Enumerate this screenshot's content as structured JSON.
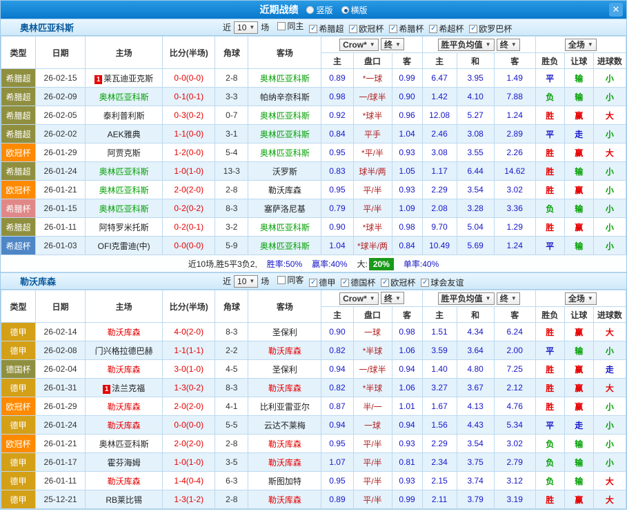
{
  "topbar": {
    "title": "近期战绩",
    "layout_options": [
      {
        "label": "竖版",
        "selected": false
      },
      {
        "label": "横版",
        "selected": true
      }
    ],
    "close_label": "✕"
  },
  "controls": {
    "recent_prefix": "近",
    "recent_count": "10",
    "recent_suffix": "场",
    "dropdown_crow": "Crow*",
    "dropdown_final_asia": "终",
    "dropdown_avg": "胜平负均值",
    "dropdown_final_eu": "终",
    "dropdown_scope": "全场"
  },
  "columns": {
    "type": "类型",
    "date": "日期",
    "home": "主场",
    "score": "比分(半场)",
    "corner": "角球",
    "away": "客场",
    "asia_home": "主",
    "asia_handicap": "盘口",
    "asia_away": "客",
    "eu_home": "主",
    "eu_draw": "和",
    "eu_away": "客",
    "result": "胜负",
    "handicap_result": "让球",
    "goals": "进球数"
  },
  "league_colors": {
    "希腊超": "#8f8f3f",
    "欧冠杯": "#ff8a00",
    "希腊杯": "#e08888",
    "希超杯": "#4e86c6",
    "德甲": "#d4a017",
    "德国杯": "#8f8f3f"
  },
  "value_colors": {
    "胜": "#e60000",
    "平": "#1616c8",
    "负": "#00a000",
    "赢": "#e60000",
    "走": "#1616c8",
    "输": "#00a000",
    "大": "#e60000",
    "小": "#00a000"
  },
  "sections": [
    {
      "team": "奥林匹亚科斯",
      "team_color": "#00a000",
      "filters": [
        {
          "label": "同主",
          "checked": false
        },
        {
          "label": "希腊超",
          "checked": true
        },
        {
          "label": "欧冠杯",
          "checked": true
        },
        {
          "label": "希腊杯",
          "checked": true
        },
        {
          "label": "希超杯",
          "checked": true
        },
        {
          "label": "欧罗巴杯",
          "checked": true
        }
      ],
      "rows": [
        {
          "league": "希腊超",
          "date": "26-02-15",
          "home": "莱瓦迪亚克斯",
          "home_card": "1",
          "away": "奥林匹亚科斯",
          "away_hl": true,
          "score": "0-0(0-0)",
          "corner": "2-8",
          "a_home": "0.89",
          "a_hcp": "*一球",
          "a_away": "0.99",
          "e_home": "6.47",
          "e_draw": "3.95",
          "e_away": "1.49",
          "result": "平",
          "hcp_res": "输",
          "goals": "小"
        },
        {
          "league": "希腊超",
          "date": "26-02-09",
          "home": "奥林匹亚科斯",
          "home_hl": true,
          "away": "帕纳辛奈科斯",
          "score": "0-1(0-1)",
          "corner": "3-3",
          "a_home": "0.98",
          "a_hcp": "一/球半",
          "a_away": "0.90",
          "e_home": "1.42",
          "e_draw": "4.10",
          "e_away": "7.88",
          "result": "负",
          "hcp_res": "输",
          "goals": "小"
        },
        {
          "league": "希腊超",
          "date": "26-02-05",
          "home": "泰利普利斯",
          "away": "奥林匹亚科斯",
          "away_hl": true,
          "score": "0-3(0-2)",
          "corner": "0-7",
          "a_home": "0.92",
          "a_hcp": "*球半",
          "a_away": "0.96",
          "e_home": "12.08",
          "e_draw": "5.27",
          "e_away": "1.24",
          "result": "胜",
          "hcp_res": "赢",
          "goals": "大"
        },
        {
          "league": "希腊超",
          "date": "26-02-02",
          "home": "AEK雅典",
          "away": "奥林匹亚科斯",
          "away_hl": true,
          "score": "1-1(0-0)",
          "corner": "3-1",
          "a_home": "0.84",
          "a_hcp": "平手",
          "a_away": "1.04",
          "e_home": "2.46",
          "e_draw": "3.08",
          "e_away": "2.89",
          "result": "平",
          "hcp_res": "走",
          "goals": "小"
        },
        {
          "league": "欧冠杯",
          "date": "26-01-29",
          "home": "阿贾克斯",
          "away": "奥林匹亚科斯",
          "away_hl": true,
          "score": "1-2(0-0)",
          "corner": "5-4",
          "a_home": "0.95",
          "a_hcp": "*平/半",
          "a_away": "0.93",
          "e_home": "3.08",
          "e_draw": "3.55",
          "e_away": "2.26",
          "result": "胜",
          "hcp_res": "赢",
          "goals": "大"
        },
        {
          "league": "希腊超",
          "date": "26-01-24",
          "home": "奥林匹亚科斯",
          "home_hl": true,
          "away": "沃罗斯",
          "score": "1-0(1-0)",
          "corner": "13-3",
          "a_home": "0.83",
          "a_hcp": "球半/两",
          "a_away": "1.05",
          "e_home": "1.17",
          "e_draw": "6.44",
          "e_away": "14.62",
          "result": "胜",
          "hcp_res": "输",
          "goals": "小"
        },
        {
          "league": "欧冠杯",
          "date": "26-01-21",
          "home": "奥林匹亚科斯",
          "home_hl": true,
          "away": "勒沃库森",
          "score": "2-0(2-0)",
          "corner": "2-8",
          "a_home": "0.95",
          "a_hcp": "平/半",
          "a_away": "0.93",
          "e_home": "2.29",
          "e_draw": "3.54",
          "e_away": "3.02",
          "result": "胜",
          "hcp_res": "赢",
          "goals": "小"
        },
        {
          "league": "希腊杯",
          "date": "26-01-15",
          "home": "奥林匹亚科斯",
          "home_hl": true,
          "away": "塞萨洛尼基",
          "score": "0-2(0-2)",
          "corner": "8-3",
          "a_home": "0.79",
          "a_hcp": "平/半",
          "a_away": "1.09",
          "e_home": "2.08",
          "e_draw": "3.28",
          "e_away": "3.36",
          "result": "负",
          "hcp_res": "输",
          "goals": "小"
        },
        {
          "league": "希腊超",
          "date": "26-01-11",
          "home": "阿特罗米托斯",
          "away": "奥林匹亚科斯",
          "away_hl": true,
          "score": "0-2(0-1)",
          "corner": "3-2",
          "a_home": "0.90",
          "a_hcp": "*球半",
          "a_away": "0.98",
          "e_home": "9.70",
          "e_draw": "5.04",
          "e_away": "1.29",
          "result": "胜",
          "hcp_res": "赢",
          "goals": "小"
        },
        {
          "league": "希超杯",
          "date": "26-01-03",
          "home": "OFI克雷迪(中)",
          "away": "奥林匹亚科斯",
          "away_hl": true,
          "score": "0-0(0-0)",
          "corner": "5-9",
          "a_home": "1.04",
          "a_hcp": "*球半/两",
          "a_away": "0.84",
          "e_home": "10.49",
          "e_draw": "5.69",
          "e_away": "1.24",
          "result": "平",
          "hcp_res": "输",
          "goals": "小"
        }
      ],
      "summary": {
        "record": "近10场,胜5平3负2,",
        "win_rate": "胜率:50%",
        "cover_rate": "赢率:40%",
        "big_label": "大:",
        "big_value": "20%",
        "single_rate": "单率:40%"
      }
    },
    {
      "team": "勒沃库森",
      "team_color": "#e60000",
      "filters": [
        {
          "label": "同客",
          "checked": false
        },
        {
          "label": "德甲",
          "checked": true
        },
        {
          "label": "德国杯",
          "checked": true
        },
        {
          "label": "欧冠杯",
          "checked": true
        },
        {
          "label": "球会友谊",
          "checked": true
        }
      ],
      "rows": [
        {
          "league": "德甲",
          "date": "26-02-14",
          "home": "勒沃库森",
          "home_hl": true,
          "away": "圣保利",
          "score": "4-0(2-0)",
          "corner": "8-3",
          "a_home": "0.90",
          "a_hcp": "一球",
          "a_away": "0.98",
          "e_home": "1.51",
          "e_draw": "4.34",
          "e_away": "6.24",
          "result": "胜",
          "hcp_res": "赢",
          "goals": "大"
        },
        {
          "league": "德甲",
          "date": "26-02-08",
          "home": "门兴格拉德巴赫",
          "away": "勒沃库森",
          "away_hl": true,
          "score": "1-1(1-1)",
          "corner": "2-2",
          "a_home": "0.82",
          "a_hcp": "*半球",
          "a_away": "1.06",
          "e_home": "3.59",
          "e_draw": "3.64",
          "e_away": "2.00",
          "result": "平",
          "hcp_res": "输",
          "goals": "小"
        },
        {
          "league": "德国杯",
          "date": "26-02-04",
          "home": "勒沃库森",
          "home_hl": true,
          "away": "圣保利",
          "score": "3-0(1-0)",
          "corner": "4-5",
          "a_home": "0.94",
          "a_hcp": "一/球半",
          "a_away": "0.94",
          "e_home": "1.40",
          "e_draw": "4.80",
          "e_away": "7.25",
          "result": "胜",
          "hcp_res": "赢",
          "goals": "走"
        },
        {
          "league": "德甲",
          "date": "26-01-31",
          "home": "法兰克福",
          "home_card": "1",
          "away": "勒沃库森",
          "away_hl": true,
          "score": "1-3(0-2)",
          "corner": "8-3",
          "a_home": "0.82",
          "a_hcp": "*半球",
          "a_away": "1.06",
          "e_home": "3.27",
          "e_draw": "3.67",
          "e_away": "2.12",
          "result": "胜",
          "hcp_res": "赢",
          "goals": "大"
        },
        {
          "league": "欧冠杯",
          "date": "26-01-29",
          "home": "勒沃库森",
          "home_hl": true,
          "away": "比利亚雷亚尔",
          "score": "2-0(2-0)",
          "corner": "4-1",
          "a_home": "0.87",
          "a_hcp": "半/一",
          "a_away": "1.01",
          "e_home": "1.67",
          "e_draw": "4.13",
          "e_away": "4.76",
          "result": "胜",
          "hcp_res": "赢",
          "goals": "小"
        },
        {
          "league": "德甲",
          "date": "26-01-24",
          "home": "勒沃库森",
          "home_hl": true,
          "away": "云达不莱梅",
          "score": "0-0(0-0)",
          "corner": "5-5",
          "a_home": "0.94",
          "a_hcp": "一球",
          "a_away": "0.94",
          "e_home": "1.56",
          "e_draw": "4.43",
          "e_away": "5.34",
          "result": "平",
          "hcp_res": "走",
          "goals": "小"
        },
        {
          "league": "欧冠杯",
          "date": "26-01-21",
          "home": "奥林匹亚科斯",
          "away": "勒沃库森",
          "away_hl": true,
          "score": "2-0(2-0)",
          "corner": "2-8",
          "a_home": "0.95",
          "a_hcp": "平/半",
          "a_away": "0.93",
          "e_home": "2.29",
          "e_draw": "3.54",
          "e_away": "3.02",
          "result": "负",
          "hcp_res": "输",
          "goals": "小"
        },
        {
          "league": "德甲",
          "date": "26-01-17",
          "home": "霍芬海姆",
          "away": "勒沃库森",
          "away_hl": true,
          "score": "1-0(1-0)",
          "corner": "3-5",
          "a_home": "1.07",
          "a_hcp": "平/半",
          "a_away": "0.81",
          "e_home": "2.34",
          "e_draw": "3.75",
          "e_away": "2.79",
          "result": "负",
          "hcp_res": "输",
          "goals": "小"
        },
        {
          "league": "德甲",
          "date": "26-01-11",
          "home": "勒沃库森",
          "home_hl": true,
          "away": "斯图加特",
          "score": "1-4(0-4)",
          "corner": "6-3",
          "a_home": "0.95",
          "a_hcp": "平/半",
          "a_away": "0.93",
          "e_home": "2.15",
          "e_draw": "3.74",
          "e_away": "3.12",
          "result": "负",
          "hcp_res": "输",
          "goals": "大"
        },
        {
          "league": "德甲",
          "date": "25-12-21",
          "home": "RB莱比锡",
          "away": "勒沃库森",
          "away_hl": true,
          "score": "1-3(1-2)",
          "corner": "2-8",
          "a_home": "0.89",
          "a_hcp": "平/半",
          "a_away": "0.99",
          "e_home": "2.11",
          "e_draw": "3.79",
          "e_away": "3.19",
          "result": "胜",
          "hcp_res": "赢",
          "goals": "大"
        }
      ],
      "summary": null
    }
  ]
}
